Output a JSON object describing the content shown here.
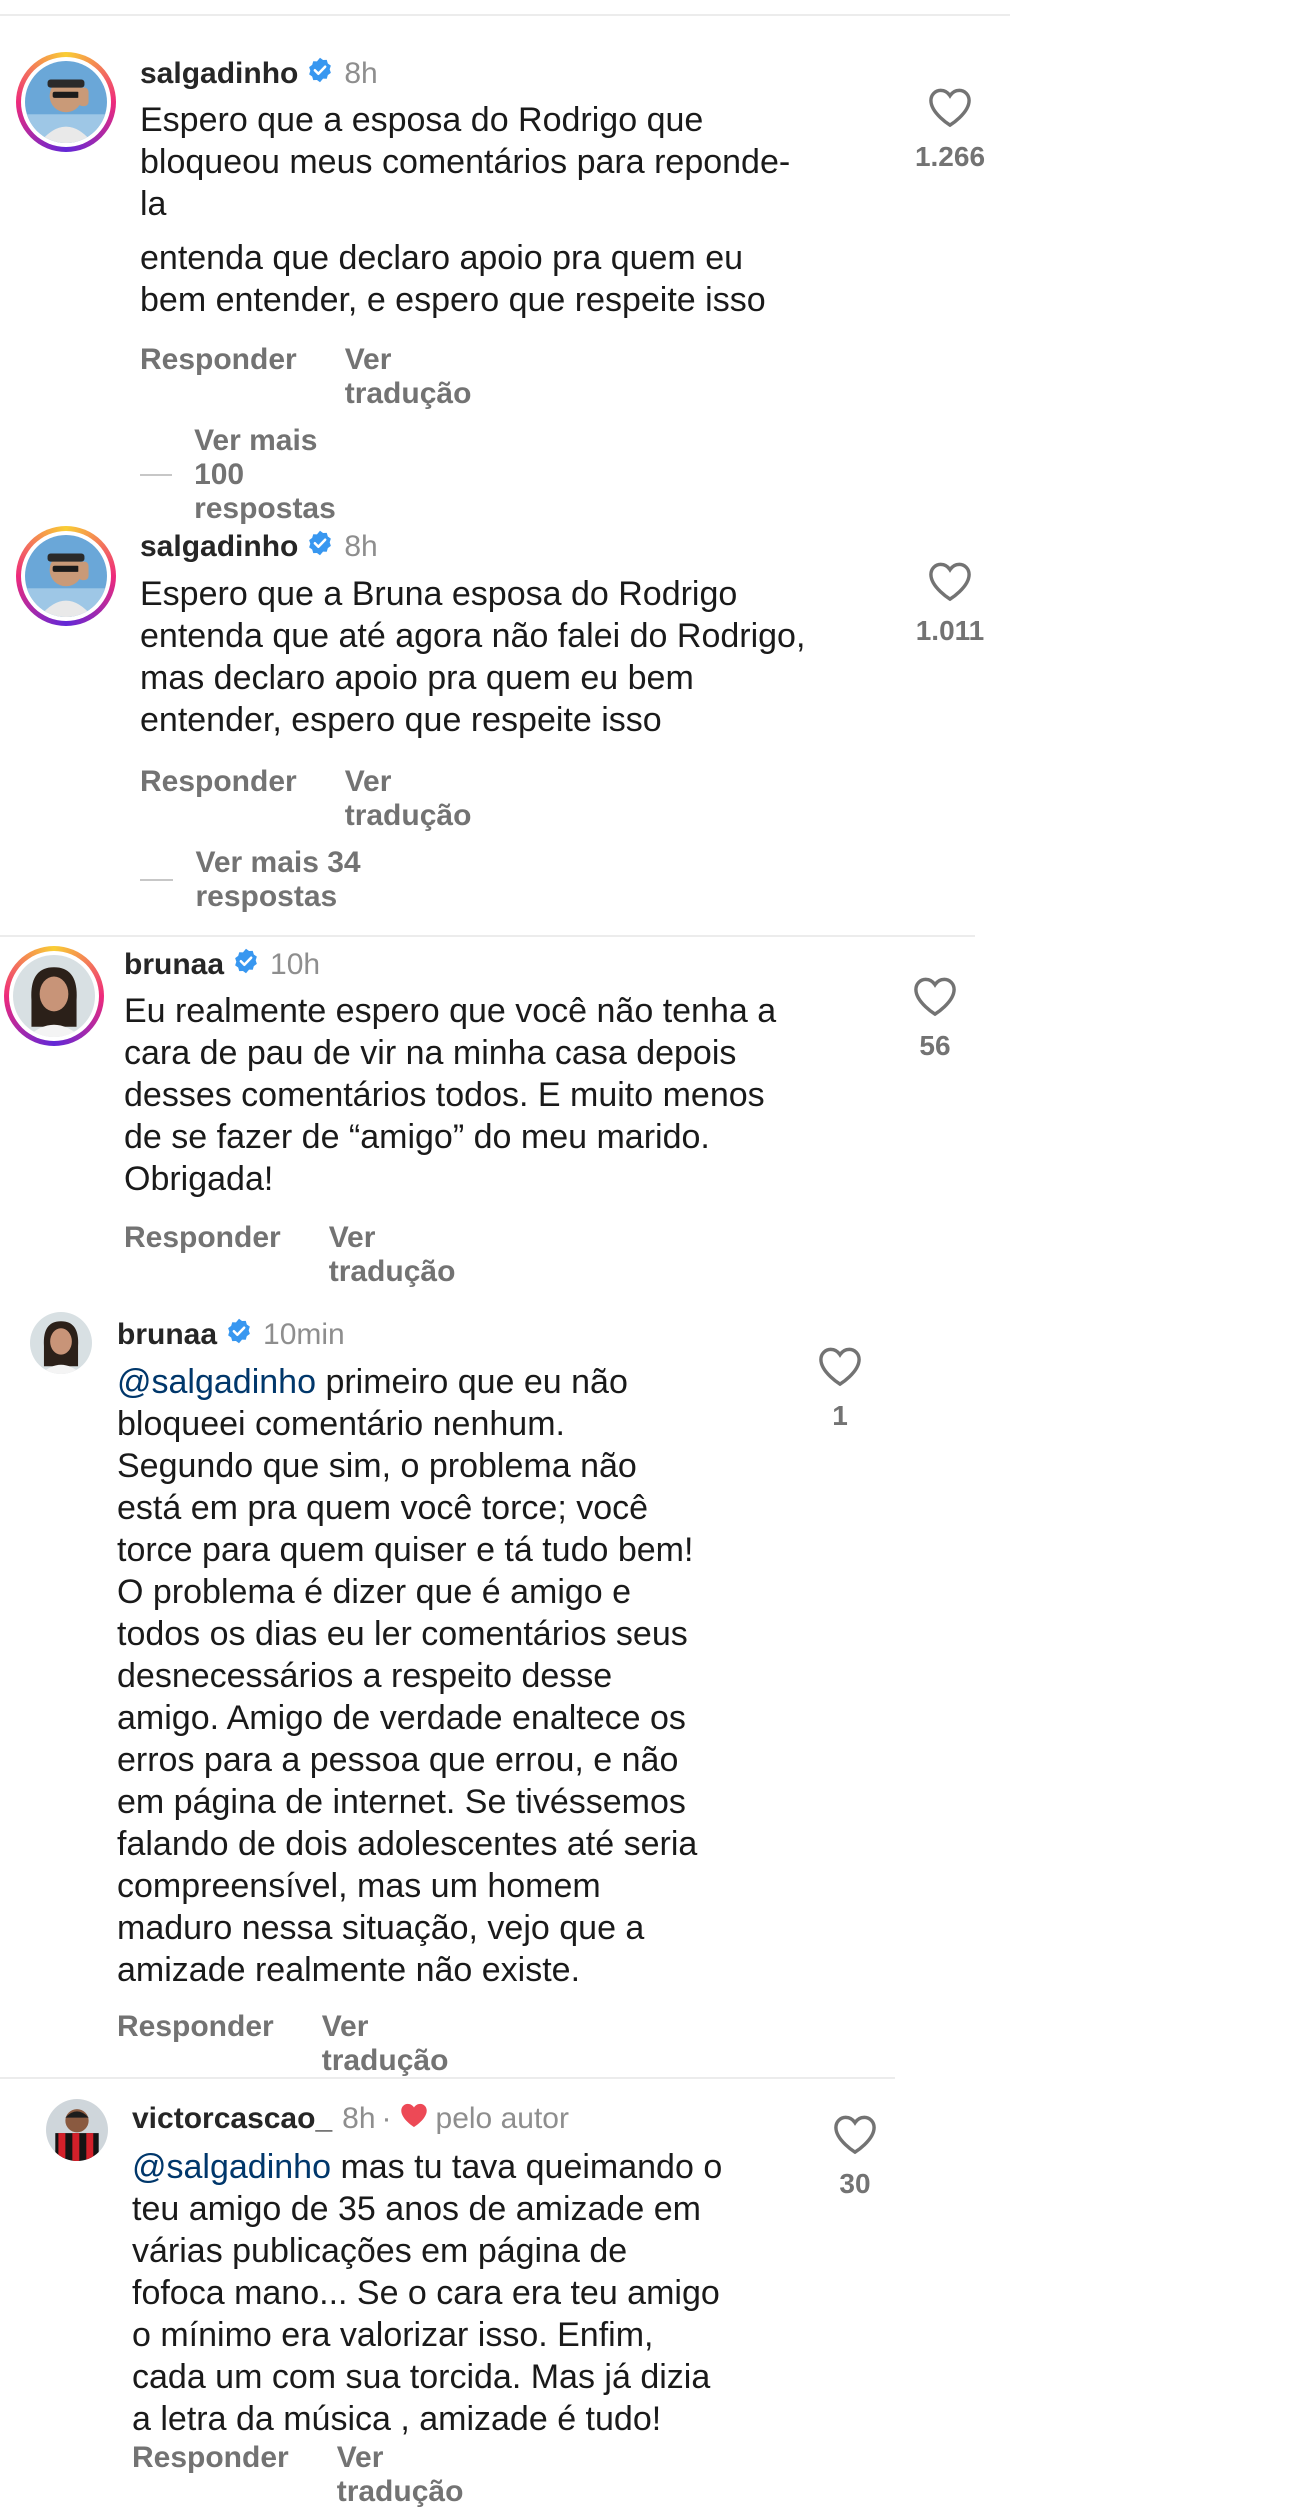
{
  "comments": [
    {
      "username": "salgadinho",
      "time": "8h",
      "text": [
        "Espero que a esposa do Rodrigo que",
        "bloqueou meus comentários para reponde-",
        "la",
        "entenda que declaro apoio pra quem eu",
        "bem entender, e espero que respeite isso"
      ],
      "likes": "1.266",
      "reply_label": "Responder",
      "translate_label": "Ver tradução",
      "more_replies": "Ver mais 100 respostas"
    },
    {
      "username": "salgadinho",
      "time": "8h",
      "text": [
        "Espero que a Bruna esposa do Rodrigo",
        "entenda que até agora não falei do Rodrigo,",
        "mas declaro apoio pra quem eu bem",
        "entender, espero que respeite isso"
      ],
      "likes": "1.011",
      "reply_label": "Responder",
      "translate_label": "Ver tradução",
      "more_replies": "Ver mais 34 respostas"
    },
    {
      "username": "brunaa",
      "time": "10h",
      "text": [
        "Eu realmente espero que você não tenha a",
        "cara de pau de vir na minha casa depois",
        "desses comentários todos. E muito menos",
        "de se fazer de “amigo” do meu marido.",
        "Obrigada!"
      ],
      "likes": "56",
      "reply_label": "Responder",
      "translate_label": "Ver tradução"
    },
    {
      "username": "brunaa",
      "time": "10min",
      "mention": "@salgadinho",
      "text": [
        " primeiro que eu não",
        "bloqueei comentário nenhum.",
        "Segundo que sim, o problema não",
        "está em pra quem você torce; você",
        "torce para quem quiser e tá tudo bem!",
        "O problema é dizer que é amigo e",
        "todos os dias eu ler comentários seus",
        "desnecessários a respeito desse",
        "amigo. Amigo de verdade enaltece os",
        "erros para a pessoa que errou, e não",
        "em página de internet. Se tivéssemos",
        "falando de dois adolescentes até seria",
        "compreensível, mas um homem",
        "maduro nessa situação, vejo que a",
        "amizade realmente não existe."
      ],
      "likes": "1",
      "reply_label": "Responder",
      "translate_label": "Ver tradução"
    },
    {
      "username": "victorcascao_",
      "time": "8h",
      "separator": "·",
      "author_label": "pelo autor",
      "mention": "@salgadinho",
      "text": [
        " mas tu tava queimando o",
        "teu amigo de 35 anos de amizade em",
        "várias publicações em página de",
        "fofoca mano... Se o cara era teu amigo",
        "o mínimo era valorizar isso. Enfim,",
        "cada um com sua torcida. Mas já dizia",
        "a letra da música , amizade é tudo!"
      ],
      "likes": "30",
      "reply_label": "Responder",
      "translate_label": "Ver tradução"
    }
  ],
  "icons": {
    "verified": "verified-badge-icon",
    "like": "heart-outline-icon",
    "author_like": "heart-filled-icon"
  },
  "colors": {
    "verified": "#3897f0",
    "author_heart": "#ed4956",
    "mention": "#00376b",
    "secondary_text": "#737373"
  }
}
